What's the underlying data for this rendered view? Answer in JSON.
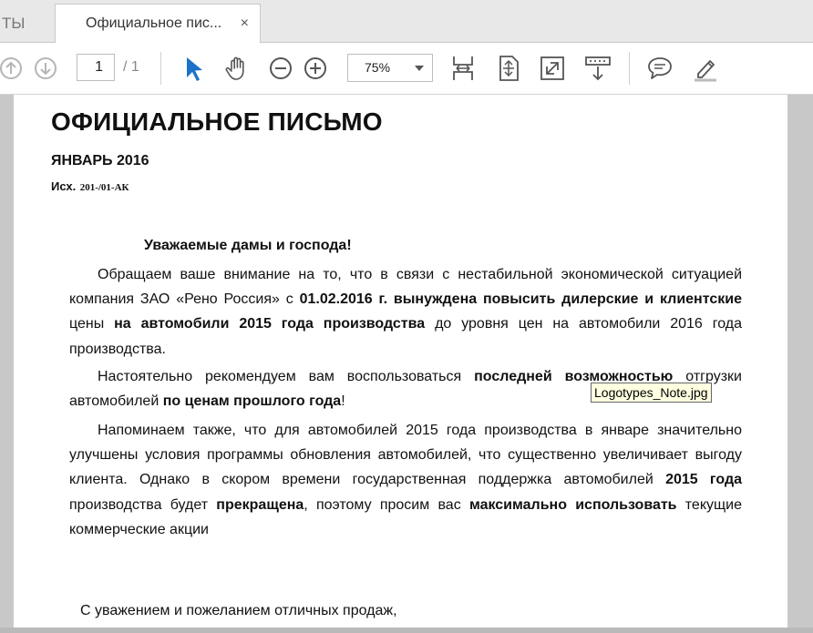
{
  "tabs": {
    "previous_label": "ТЫ",
    "active_label": "Официальное пис...",
    "close_glyph": "×"
  },
  "toolbar": {
    "page_number": "1",
    "page_total": "/ 1",
    "zoom": "75%",
    "icons": [
      "arrow-up-icon",
      "arrow-down-icon",
      "select-arrow-icon",
      "hand-icon",
      "zoom-out-icon",
      "zoom-in-icon",
      "fit-width-icon",
      "fit-page-icon",
      "fullscreen-icon",
      "scroll-mode-icon",
      "comment-icon",
      "highlight-pen-icon"
    ],
    "accent_color": "#1a73c8"
  },
  "document": {
    "title": "ОФИЦИАЛЬНОЕ ПИСЬМО",
    "month": "ЯНВАРЬ 2016",
    "ref_label": "Исх.",
    "ref_code": "201-/01-АК",
    "greeting": "Уважаемые дамы и господа!",
    "p1": {
      "a": "Обращаем ваше внимание на то, что в связи с нестабильной экономической ситуацией компания ЗАО «Рено Россия» с ",
      "b": "01.02.2016 г. вынуждена повысить дилерские и клиентские",
      "c": " цены ",
      "d": "на автомобили 2015 года производства",
      "e": " до уровня цен на автомобили 2016 года производства."
    },
    "p2": {
      "a": "Настоятельно рекомендуем вам воспользоваться ",
      "b": "последней возможностью",
      "c": " отгрузки автомобилей ",
      "d": "по ценам прошлого года",
      "e": "!"
    },
    "p3": {
      "a": "Напоминаем также, что для автомобилей 2015 года производства в январе значительно улучшены условия программы обновления автомобилей, что существенно увеличивает выгоду клиента. Однако в скором времени государственная поддержка автомобилей ",
      "b": "2015 года",
      "c": " производства будет ",
      "d": "прекращена",
      "e": ", поэтому просим вас ",
      "f": "максимально использовать",
      "g": " текущие коммерческие акции"
    },
    "closing": "С уважением и пожеланием отличных продаж,"
  },
  "tooltip": "Logotypes_Note.jpg"
}
